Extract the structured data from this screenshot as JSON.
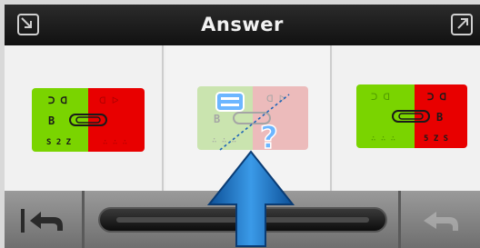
{
  "window": {
    "title": "Answer",
    "shrink_icon": "shrink-icon",
    "expand_icon": "expand-icon"
  },
  "cards": [
    {
      "id": "left",
      "left_color": "#7ad400",
      "right_color": "#e80000",
      "selected": false
    },
    {
      "id": "middle",
      "left_color": "#8ed04a",
      "right_color": "#e46a6a",
      "selected": true,
      "overlay_icons": [
        "equals-icon",
        "question-icon",
        "dashed-line-icon"
      ]
    },
    {
      "id": "right",
      "left_color": "#7ad400",
      "right_color": "#e80000",
      "selected": false
    }
  ],
  "toolbar": {
    "back_icon": "back-arrow-icon",
    "forward_icon": "forward-arrow-icon",
    "slider": "slider"
  },
  "colors": {
    "titlebar": "#1e1e1e",
    "arrow": "#1b6fc0"
  }
}
